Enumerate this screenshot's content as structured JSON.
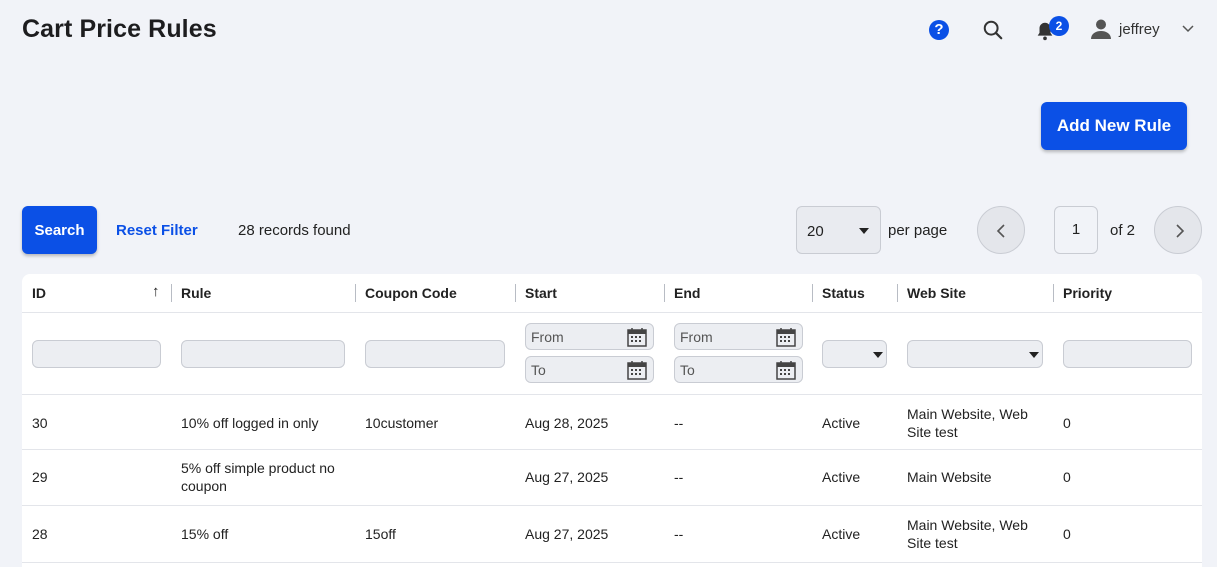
{
  "page": {
    "title": "Cart Price Rules"
  },
  "header": {
    "notifications_count": "2",
    "user_name": "jeffrey"
  },
  "actions": {
    "add_new_rule": "Add New Rule",
    "search": "Search",
    "reset_filter": "Reset Filter"
  },
  "toolbar": {
    "records_found": "28 records found",
    "per_page_value": "20",
    "per_page_label": "per page",
    "current_page": "1",
    "total_pages_label": "of 2"
  },
  "grid": {
    "columns": [
      "ID",
      "Rule",
      "Coupon Code",
      "Start",
      "End",
      "Status",
      "Web Site",
      "Priority"
    ],
    "filters": {
      "from_placeholder": "From",
      "to_placeholder": "To"
    },
    "rows": [
      {
        "id": "30",
        "rule": "10% off logged in only",
        "coupon": "10customer",
        "start": "Aug 28, 2025",
        "end": "--",
        "status": "Active",
        "website": "Main Website, Web Site test",
        "priority": "0"
      },
      {
        "id": "29",
        "rule": "5% off simple product no coupon",
        "coupon": "",
        "start": "Aug 27, 2025",
        "end": "--",
        "status": "Active",
        "website": "Main Website",
        "priority": "0"
      },
      {
        "id": "28",
        "rule": "15% off",
        "coupon": "15off",
        "start": "Aug 27, 2025",
        "end": "--",
        "status": "Active",
        "website": "Main Website, Web Site test",
        "priority": "0"
      }
    ]
  },
  "colors": {
    "accent": "#0b50e6",
    "background": "#f1f3f8"
  }
}
